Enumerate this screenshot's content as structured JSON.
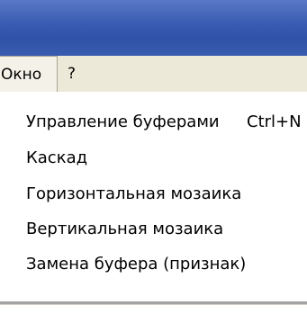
{
  "menu_bar": {
    "items": [
      {
        "label": "Окно"
      },
      {
        "label": "?"
      }
    ]
  },
  "window_menu": {
    "items": [
      {
        "label": "Управление буферами",
        "shortcut": "Ctrl+N"
      },
      {
        "label": "Каскад"
      },
      {
        "label": "Горизонтальная мозаика"
      },
      {
        "label": "Вертикальная мозаика"
      },
      {
        "label": "Замена буфера (признак)"
      }
    ]
  },
  "colors": {
    "title_bar": "#3b5db3",
    "menu_bar": "#ece9d8",
    "menu_background": "#ffffff"
  }
}
